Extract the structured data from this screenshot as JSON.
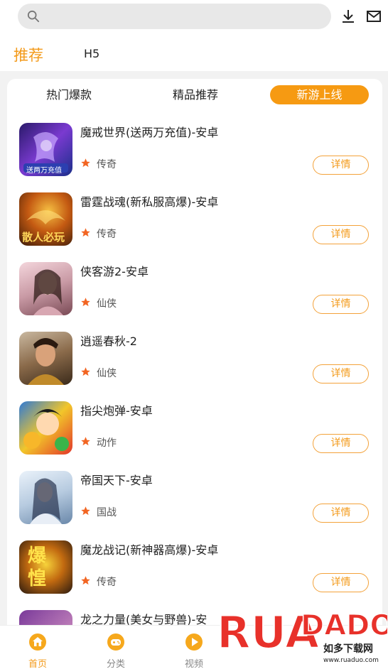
{
  "search": {
    "value": "",
    "placeholder": ""
  },
  "header_icons": [
    "download-icon",
    "mail-icon"
  ],
  "channels": [
    {
      "label": "推荐",
      "active": true
    },
    {
      "label": "H5",
      "active": false
    }
  ],
  "segments": [
    {
      "label": "热门爆款",
      "active": false
    },
    {
      "label": "精品推荐",
      "active": false
    },
    {
      "label": "新游上线",
      "active": true
    }
  ],
  "games": [
    {
      "name": "魔戒世界(送两万充值)-安卓",
      "category": "传奇",
      "button": "详情",
      "thumb_text": "送两万充值"
    },
    {
      "name": "雷霆战魂(新私服高爆)-安卓",
      "category": "传奇",
      "button": "详情",
      "thumb_text": "散人必玩"
    },
    {
      "name": "侠客游2-安卓",
      "category": "仙侠",
      "button": "详情",
      "thumb_text": ""
    },
    {
      "name": "逍遥春秋-2",
      "category": "仙侠",
      "button": "详情",
      "thumb_text": ""
    },
    {
      "name": "指尖炮弹-安卓",
      "category": "动作",
      "button": "详情",
      "thumb_text": ""
    },
    {
      "name": "帝国天下-安卓",
      "category": "国战",
      "button": "详情",
      "thumb_text": ""
    },
    {
      "name": "魔龙战记(新神器高爆)-安卓",
      "category": "传奇",
      "button": "详情",
      "thumb_text": "爆惶"
    },
    {
      "name": "龙之力量(美女与野兽)-安",
      "category": "",
      "button": "",
      "thumb_text": ""
    }
  ],
  "bottom_nav": [
    {
      "label": "首页",
      "icon": "home-icon",
      "active": true
    },
    {
      "label": "分类",
      "icon": "gamepad-icon",
      "active": false
    },
    {
      "label": "视频",
      "icon": "play-icon",
      "active": false
    }
  ],
  "watermark": {
    "brand": "RUADADO",
    "cn": "如多下载网",
    "url": "www.ruaduo.com"
  },
  "colors": {
    "accent": "#f39a1a",
    "page_bg": "#f2f2f2",
    "star": "#f26522"
  }
}
